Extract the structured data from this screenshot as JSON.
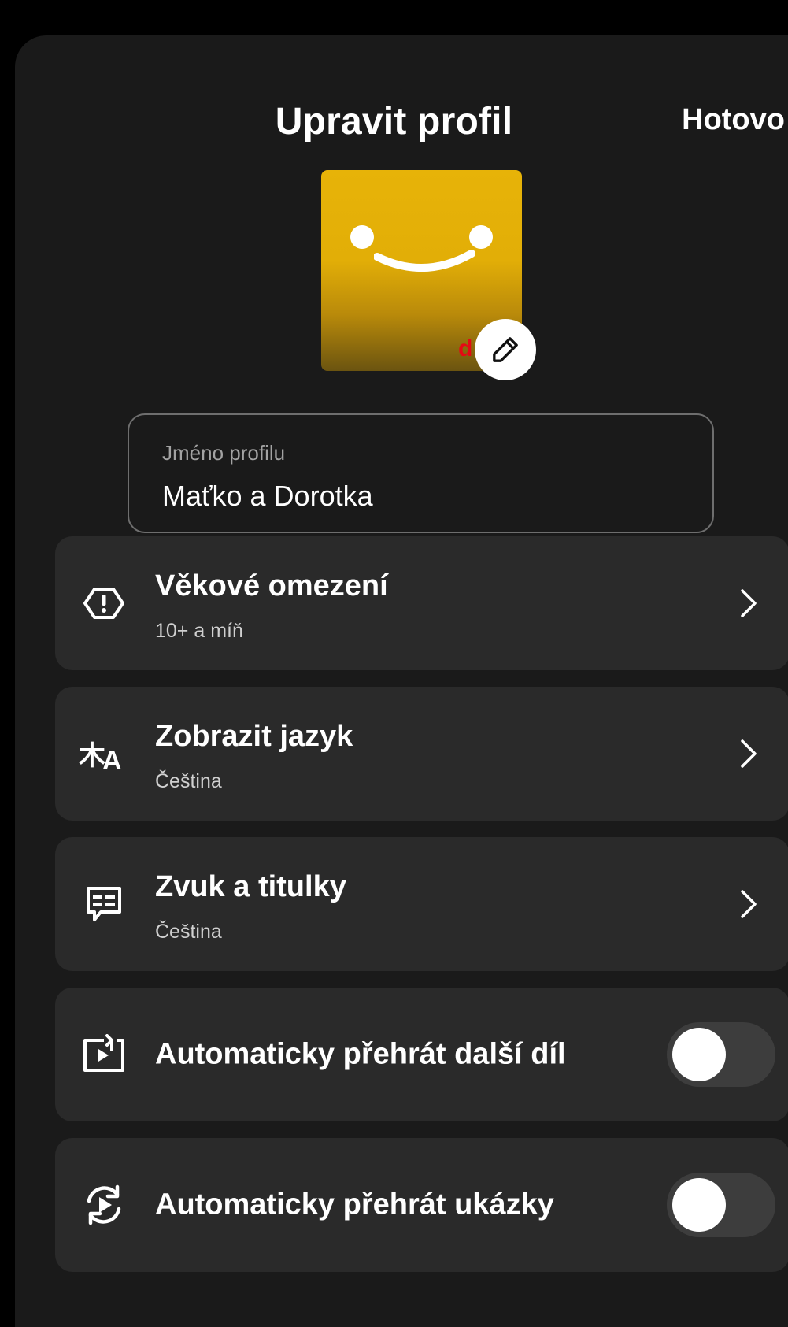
{
  "header": {
    "title": "Upravit profil",
    "done_label": "Hotovo"
  },
  "avatar": {
    "description_icon": "smiley-face-avatar",
    "edit_icon": "pencil-icon",
    "brand_mark": "d"
  },
  "name_field": {
    "label": "Jméno profilu",
    "value": "Maťko a Dorotka"
  },
  "settings": [
    {
      "icon": "maturity-rating-icon",
      "title": "Věkové omezení",
      "subtitle": "10+ a míň",
      "control": "chevron"
    },
    {
      "icon": "language-icon",
      "title": "Zobrazit jazyk",
      "subtitle": "Čeština",
      "control": "chevron"
    },
    {
      "icon": "subtitles-icon",
      "title": "Zvuk a titulky",
      "subtitle": "Čeština",
      "control": "chevron"
    },
    {
      "icon": "autoplay-next-episode-icon",
      "title": "Automaticky přehrát další díl",
      "control": "toggle",
      "toggle_on": false
    },
    {
      "icon": "autoplay-previews-icon",
      "title": "Automaticky přehrát ukázky",
      "control": "toggle",
      "toggle_on": false
    }
  ],
  "colors": {
    "background": "#000000",
    "sheet": "#1a1a1a",
    "card": "#2a2a2a",
    "avatar_yellow": "#e7b308",
    "brand_red": "#e50914",
    "toggle_track": "#3d3d3d"
  }
}
